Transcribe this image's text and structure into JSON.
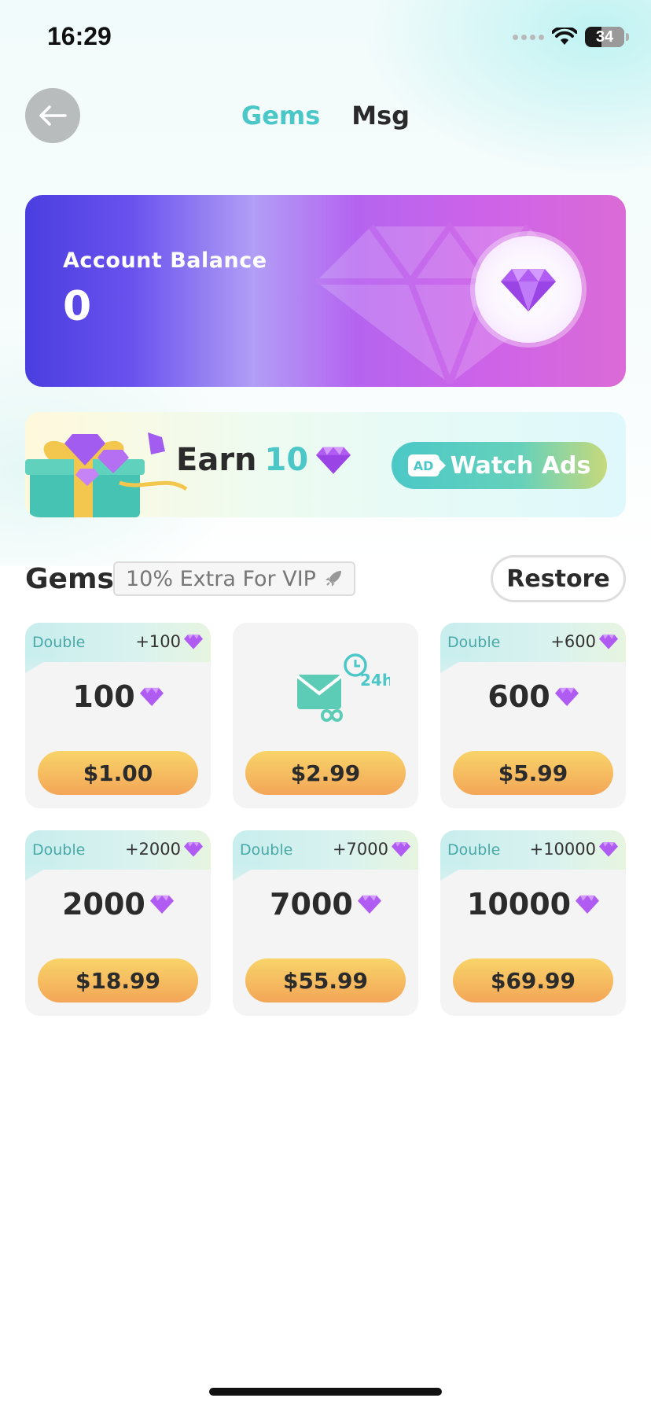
{
  "status_bar": {
    "time": "16:29",
    "battery": "34"
  },
  "header": {
    "tabs": [
      {
        "label": "Gems",
        "active": true
      },
      {
        "label": "Msg",
        "active": false
      }
    ]
  },
  "balance": {
    "label": "Account Balance",
    "value": "0"
  },
  "earn": {
    "prefix": "Earn",
    "amount": "10",
    "button_label": "Watch Ads",
    "ad_badge": "AD"
  },
  "gems_section": {
    "title": "Gems",
    "vip_note": "10% Extra For VIP",
    "restore_label": "Restore"
  },
  "packs": [
    {
      "tag": "Double",
      "bonus": "+100",
      "amount": "100",
      "price": "$1.00"
    },
    {
      "tag": "",
      "bonus": "",
      "amount": "",
      "price": "$2.99",
      "icon": "unlimited-messages-24h-icon",
      "icon_text": "24h"
    },
    {
      "tag": "Double",
      "bonus": "+600",
      "amount": "600",
      "price": "$5.99"
    },
    {
      "tag": "Double",
      "bonus": "+2000",
      "amount": "2000",
      "price": "$18.99"
    },
    {
      "tag": "Double",
      "bonus": "+7000",
      "amount": "7000",
      "price": "$55.99"
    },
    {
      "tag": "Double",
      "bonus": "+10000",
      "amount": "10000",
      "price": "$69.99"
    }
  ],
  "colors": {
    "accent": "#4cc7c8",
    "gem": "#a35cf0",
    "price_button_top": "#f8d46a",
    "price_button_bottom": "#f3a657"
  }
}
